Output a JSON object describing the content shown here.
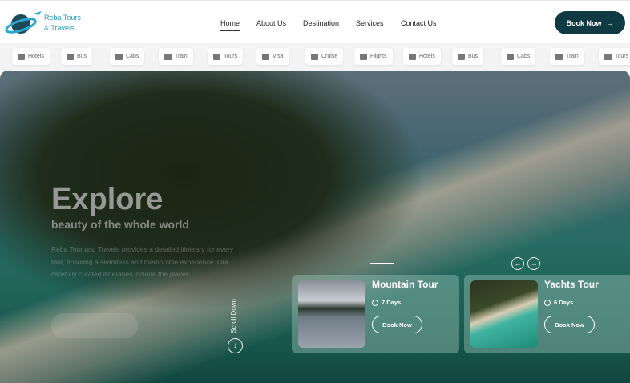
{
  "brand": {
    "line1": "Reba Tours",
    "line2": "& Travels"
  },
  "nav": [
    {
      "label": "Home",
      "active": true
    },
    {
      "label": "About Us"
    },
    {
      "label": "Destination"
    },
    {
      "label": "Services"
    },
    {
      "label": "Contact Us"
    }
  ],
  "header": {
    "book_label": "Book Now",
    "accent": "#0f3a44"
  },
  "categories": [
    "Hotels",
    "Bus",
    "Cabs",
    "Train",
    "Tours",
    "Visa",
    "Cruise",
    "Flights",
    "Hotels",
    "Bus",
    "Cabs",
    "Train",
    "Tours"
  ],
  "hero": {
    "title": "Explore",
    "subtitle": "beauty of the whole world",
    "description": "Reba Tour and Travels provides a detailed itinerary for every tour, ensuring a seamless and memorable experience. Our carefully curated itineraries include the places...",
    "scroll_label": "Scroll Down"
  },
  "tours": [
    {
      "name": "Mountain Tour",
      "duration": "7 Days",
      "button": "Book Now"
    },
    {
      "name": "Yachts Tour",
      "duration": "6 Days",
      "button": "Book Now"
    }
  ]
}
